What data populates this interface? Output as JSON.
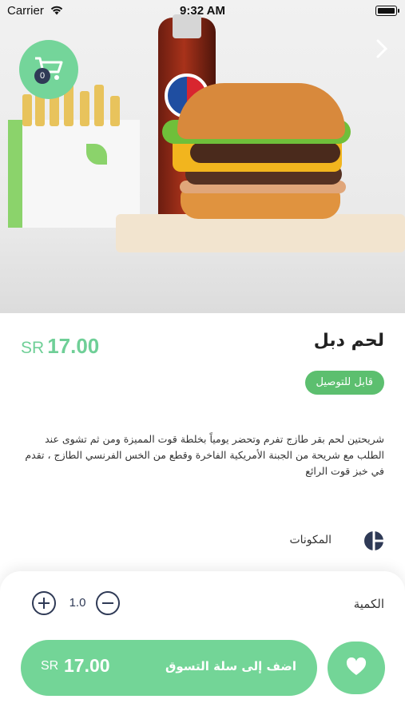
{
  "status_bar": {
    "carrier": "Carrier",
    "time": "9:32 AM"
  },
  "cart": {
    "count": "0",
    "icon": "cart-icon"
  },
  "nav": {
    "back_icon": "chevron-right-icon"
  },
  "product": {
    "name": "لحم دبل",
    "currency": "SR",
    "price": "17.00",
    "badge": "قابل للتوصيل",
    "description": "شريحتين لحم بقر طازج تفرم وتحضر يومياً بخلطة قوت المميزة ومن ثم تشوى عند الطلب مع شريحة من الجبنة الأمريكية الفاخرة وقطع من الخس الفرنسي الطازج ، تقدم في خبز قوت الرائع",
    "ingredients_label": "المكونات"
  },
  "order": {
    "quantity_label": "الكمية",
    "quantity": "1.0",
    "add_to_cart_label": "اضف إلى سلة التسوق",
    "currency": "SR",
    "total": "17.00"
  },
  "colors": {
    "accent": "#73d597",
    "dark": "#2f3a56",
    "badge": "#5cbf6f"
  }
}
